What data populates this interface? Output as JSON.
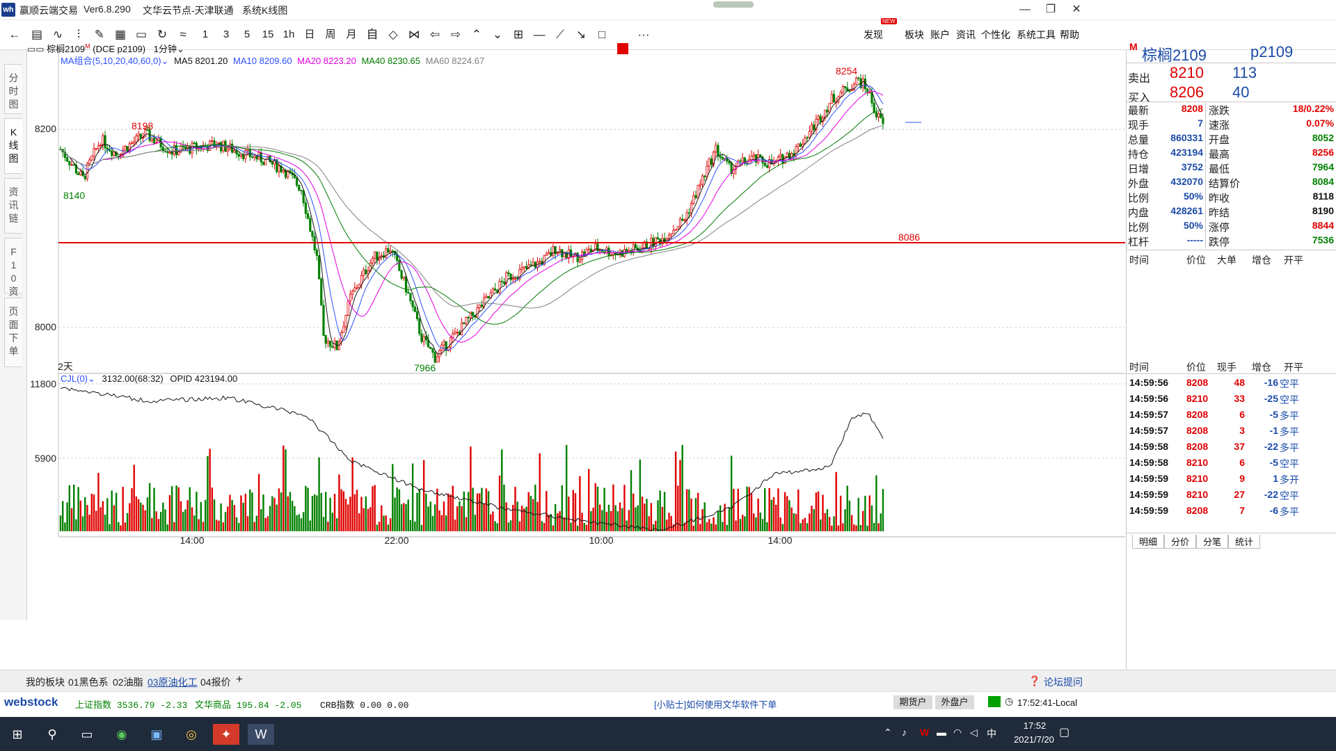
{
  "window": {
    "app_name": "赢顺云端交易",
    "version": "Ver6.8.290",
    "server": "文华云节点-天津联通",
    "view": "系统K线图",
    "minimize": "—",
    "maximize": "❐",
    "close": "✕"
  },
  "toolbar": {
    "periods": [
      "1",
      "3",
      "5",
      "15",
      "1h",
      "日",
      "周",
      "月"
    ],
    "menu": [
      "发现",
      "板块",
      "账户",
      "资讯",
      "个性化",
      "系统工具",
      "帮助"
    ],
    "new_badge": "NEW",
    "more": "···"
  },
  "side_tabs": [
    "分时图",
    "K线图",
    "资讯链",
    "F10资料",
    "页面下单"
  ],
  "chart_header": {
    "symbol": "棕榈2109",
    "symbol_sup": "M",
    "exchange": "(DCE p2109)",
    "period": "1分钟",
    "ma_group": "MA组合(5,10,20,40,60,0)",
    "ma5": "MA5 8201.20",
    "ma10": "MA10 8209.60",
    "ma20": "MA20 8223.20",
    "ma40": "MA40 8230.65",
    "ma60": "MA60 8224.67",
    "days": "2天"
  },
  "chart_labels": {
    "high_left": "8198",
    "low_left": "8140",
    "trough": "7966",
    "peak": "8254",
    "line_price": "8086",
    "y_8200": "8200",
    "y_8000": "8000",
    "vol_11800": "11800",
    "vol_5900": "5900"
  },
  "volume_header": {
    "indicator": "CJL(0)",
    "value": "3132.00(68:32)",
    "opid": "OPID 423194.00"
  },
  "x_axis": [
    "14:00",
    "22:00",
    "10:00",
    "14:00"
  ],
  "colors": {
    "up": "#e00000",
    "down": "#008000",
    "ma5": "#1a1a1a",
    "ma10": "#2b4fff",
    "ma20": "#e000e0",
    "ma40": "#007a00",
    "ma60": "#808080",
    "line": "#e00000"
  },
  "quote": {
    "name": "棕榈2109",
    "code": "p2109",
    "m": "M",
    "sell_label": "卖出",
    "sell_price": "8210",
    "sell_vol": "113",
    "buy_label": "买入",
    "buy_price": "8206",
    "buy_vol": "40",
    "rows": [
      {
        "l1": "最新",
        "v1": "8208",
        "c1": "red",
        "l2": "涨跌",
        "v2": "18/0.22%",
        "c2": "red"
      },
      {
        "l1": "现手",
        "v1": "7",
        "c1": "blue",
        "l2": "速涨",
        "v2": "0.07%",
        "c2": "red"
      },
      {
        "l1": "总量",
        "v1": "860331",
        "c1": "blue",
        "l2": "开盘",
        "v2": "8052",
        "c2": "green"
      },
      {
        "l1": "持仓",
        "v1": "423194",
        "c1": "blue",
        "l2": "最高",
        "v2": "8256",
        "c2": "red"
      },
      {
        "l1": "日增",
        "v1": "3752",
        "c1": "blue",
        "l2": "最低",
        "v2": "7964",
        "c2": "green"
      },
      {
        "l1": "外盘",
        "v1": "432070",
        "c1": "blue",
        "l2": "结算价",
        "v2": "8084",
        "c2": "green"
      },
      {
        "l1": "比例",
        "v1": "50%",
        "c1": "blue",
        "l2": "昨收",
        "v2": "8118",
        "c2": "black"
      },
      {
        "l1": "内盘",
        "v1": "428261",
        "c1": "blue",
        "l2": "昨结",
        "v2": "8190",
        "c2": "black"
      },
      {
        "l1": "比例",
        "v1": "50%",
        "c1": "blue",
        "l2": "涨停",
        "v2": "8844",
        "c2": "red"
      },
      {
        "l1": "杠杆",
        "v1": "-----",
        "c1": "blue",
        "l2": "跌停",
        "v2": "7536",
        "c2": "green"
      }
    ],
    "big_header": [
      "时间",
      "价位",
      "大单",
      "增仓",
      "开平"
    ],
    "ticks_header": [
      "时间",
      "价位",
      "现手",
      "增仓",
      "开平"
    ],
    "ticks": [
      {
        "t": "14:59:56",
        "p": "8208",
        "v": "48",
        "d": "-16",
        "o": "空平",
        "oc": "blue"
      },
      {
        "t": "14:59:56",
        "p": "8210",
        "v": "33",
        "d": "-25",
        "o": "空平",
        "oc": "blue"
      },
      {
        "t": "14:59:57",
        "p": "8208",
        "v": "6",
        "d": "-5",
        "o": "多平",
        "oc": "blue"
      },
      {
        "t": "14:59:57",
        "p": "8208",
        "v": "3",
        "d": "-1",
        "o": "多平",
        "oc": "blue"
      },
      {
        "t": "14:59:58",
        "p": "8208",
        "v": "37",
        "d": "-22",
        "o": "多平",
        "oc": "blue"
      },
      {
        "t": "14:59:58",
        "p": "8210",
        "v": "6",
        "d": "-5",
        "o": "空平",
        "oc": "blue"
      },
      {
        "t": "14:59:59",
        "p": "8210",
        "v": "9",
        "d": "1",
        "o": "多开",
        "oc": "blue"
      },
      {
        "t": "14:59:59",
        "p": "8210",
        "v": "27",
        "d": "-22",
        "o": "空平",
        "oc": "blue"
      },
      {
        "t": "14:59:59",
        "p": "8208",
        "v": "7",
        "d": "-6",
        "o": "多平",
        "oc": "blue"
      }
    ],
    "bottom_tabs": [
      "明细",
      "分价",
      "分笔",
      "统计"
    ]
  },
  "sectors": [
    "我的板块",
    "01黑色系",
    "02油脂",
    "03原油化工",
    "04报价",
    "+"
  ],
  "forum": "论坛提问",
  "indexbar": {
    "logo": "webstock",
    "items": [
      {
        "name": "上证指数",
        "val": "3536.79",
        "chg": "-2.33"
      },
      {
        "name": "文华商品",
        "val": "195.84",
        "chg": "-2.05"
      },
      {
        "name": "CRB指数",
        "val": "0.00",
        "chg": "0.00"
      }
    ],
    "tip": "[小贴士]如何使用文华软件下单",
    "btn_futures": "期货户",
    "btn_forex": "外盘户",
    "clock": "17:52:41-Local"
  },
  "taskbar": {
    "time": "17:52",
    "date": "2021/7/20",
    "ime": "中"
  }
}
